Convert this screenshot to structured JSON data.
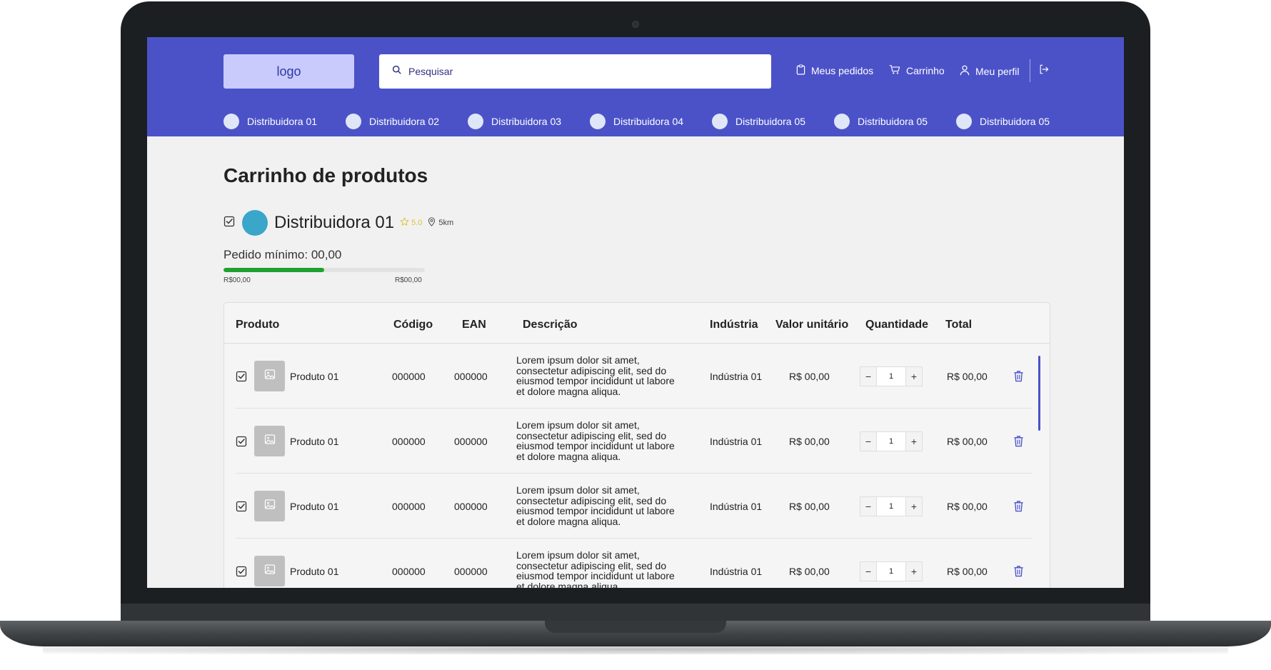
{
  "header": {
    "logo_text": "logo",
    "search_placeholder": "Pesquisar",
    "nav": {
      "orders": "Meus pedidos",
      "cart": "Carrinho",
      "profile": "Meu perfil"
    },
    "distributors": [
      "Distribuidora 01",
      "Distribuidora 02",
      "Distribuidora 03",
      "Distribuidora 04",
      "Distribuidora 05",
      "Distribuidora 05",
      "Distribuidora 05"
    ]
  },
  "page": {
    "title": "Carrinho de produtos",
    "distributor": {
      "name": "Distribuidora 01",
      "rating": "5.0",
      "distance": "5km"
    },
    "min_order_label": "Pedido mínimo: 00,00",
    "progress": {
      "fraction": 0.5,
      "min_label": "R$00,00",
      "max_label": "R$00,00"
    }
  },
  "table": {
    "headers": {
      "product": "Produto",
      "code": "Código",
      "ean": "EAN",
      "description": "Descrição",
      "industry": "Indústria",
      "unit_price": "Valor unitário",
      "quantity": "Quantidade",
      "total": "Total"
    },
    "rows": [
      {
        "product": "Produto 01",
        "code": "000000",
        "ean": "000000",
        "description": "Lorem ipsum dolor sit amet, consectetur adipiscing elit, sed do eiusmod tempor incididunt ut labore et dolore magna aliqua.",
        "industry": "Indústria 01",
        "unit_price": "R$ 00,00",
        "quantity": "1",
        "total": "R$ 00,00"
      },
      {
        "product": "Produto 01",
        "code": "000000",
        "ean": "000000",
        "description": "Lorem ipsum dolor sit amet, consectetur adipiscing elit, sed do eiusmod tempor incididunt ut labore et dolore magna aliqua.",
        "industry": "Indústria 01",
        "unit_price": "R$ 00,00",
        "quantity": "1",
        "total": "R$ 00,00"
      },
      {
        "product": "Produto 01",
        "code": "000000",
        "ean": "000000",
        "description": "Lorem ipsum dolor sit amet, consectetur adipiscing elit, sed do eiusmod tempor incididunt ut labore et dolore magna aliqua.",
        "industry": "Indústria 01",
        "unit_price": "R$ 00,00",
        "quantity": "1",
        "total": "R$ 00,00"
      },
      {
        "product": "Produto 01",
        "code": "000000",
        "ean": "000000",
        "description": "Lorem ipsum dolor sit amet, consectetur adipiscing elit, sed do eiusmod tempor incididunt ut labore et dolore magna aliqua.",
        "industry": "Indústria 01",
        "unit_price": "R$ 00,00",
        "quantity": "1",
        "total": "R$ 00,00"
      }
    ]
  },
  "colors": {
    "brand": "#4b52c8",
    "logo_bg": "#c8cbfb",
    "progress": "#1fa12f",
    "avatar": "#3aa6c9",
    "star": "#e2c234"
  },
  "icons": [
    "search-icon",
    "clipboard-icon",
    "cart-icon",
    "user-icon",
    "logout-icon",
    "checkbox-icon",
    "star-icon",
    "location-pin-icon",
    "image-icon",
    "trash-icon"
  ]
}
